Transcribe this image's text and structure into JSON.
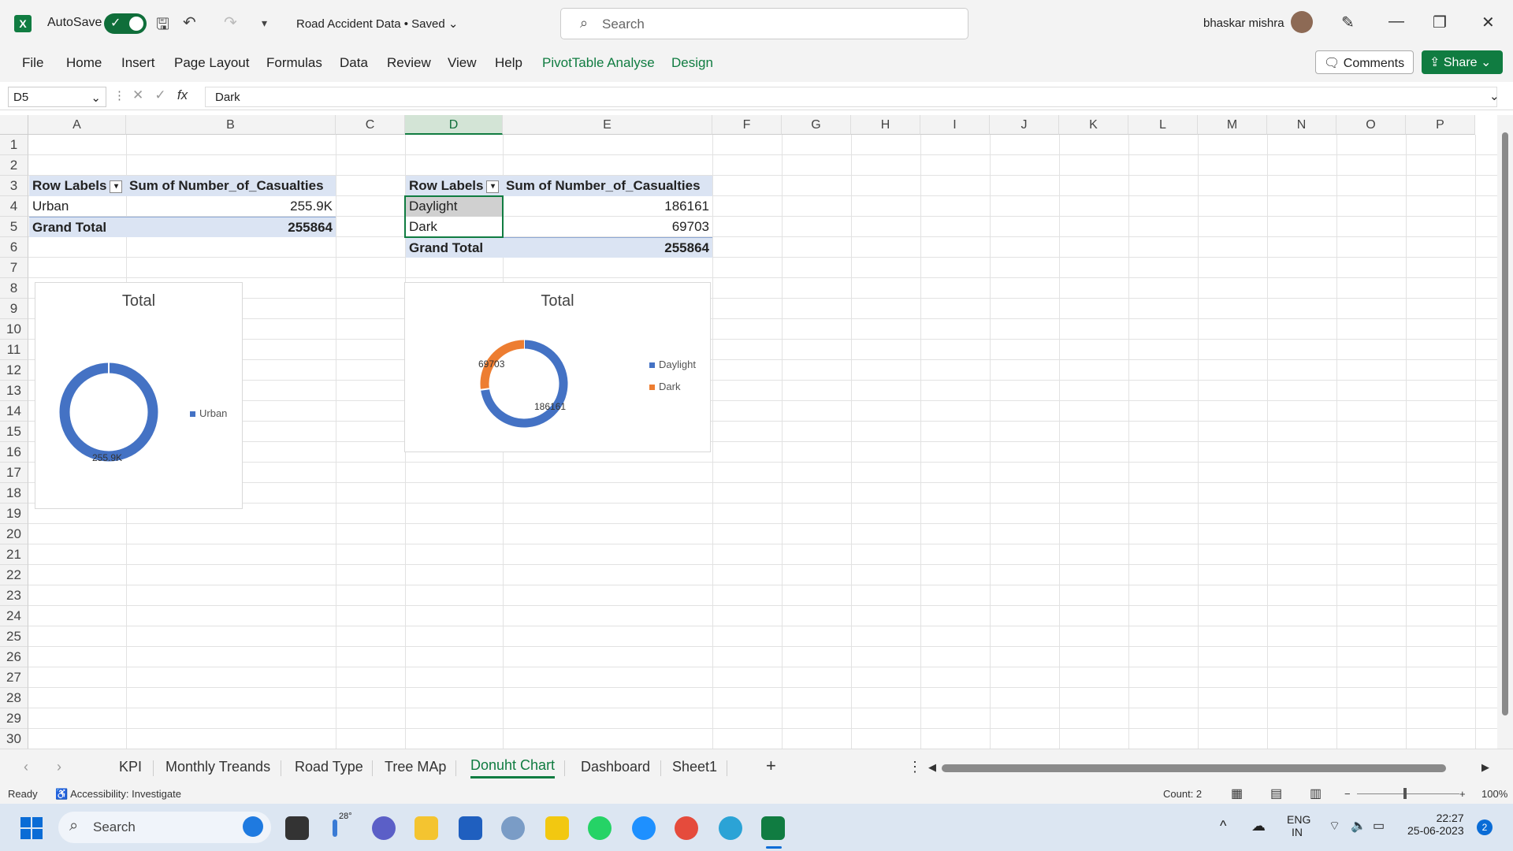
{
  "app": {
    "autosave_label": "AutoSave",
    "doc_title": "Road Accident Data • Saved",
    "search_placeholder": "Search",
    "user_name": "bhaskar mishra"
  },
  "menu": [
    "File",
    "Home",
    "Insert",
    "Page Layout",
    "Formulas",
    "Data",
    "Review",
    "View",
    "Help",
    "PivotTable Analyse",
    "Design"
  ],
  "buttons": {
    "comments": "Comments",
    "share": "Share"
  },
  "formula_bar": {
    "name_box": "D5",
    "formula": "Dark",
    "fx": "fx"
  },
  "columns": [
    "A",
    "B",
    "C",
    "D",
    "E",
    "F",
    "G",
    "H",
    "I",
    "J",
    "K",
    "L",
    "M",
    "N",
    "O",
    "P"
  ],
  "rows": [
    "1",
    "2",
    "3",
    "4",
    "5",
    "6",
    "7",
    "8",
    "9",
    "10",
    "11",
    "12",
    "13",
    "14",
    "15",
    "16",
    "17",
    "18",
    "19",
    "20",
    "21",
    "22",
    "23",
    "24",
    "25",
    "26",
    "27",
    "28",
    "29",
    "30"
  ],
  "pivot1": {
    "header_label": "Row Labels",
    "header_value": "Sum of Number_of_Casualties",
    "row_label": "Urban",
    "row_value": "255.9K",
    "total_label": "Grand Total",
    "total_value": "255864"
  },
  "pivot2": {
    "header_label": "Row Labels",
    "header_value": "Sum of Number_of_Casualties",
    "rows": [
      {
        "label": "Daylight",
        "value": "186161"
      },
      {
        "label": "Dark",
        "value": "69703"
      }
    ],
    "total_label": "Grand Total",
    "total_value": "255864"
  },
  "chart_data": [
    {
      "type": "pie",
      "variant": "donut",
      "title": "Total",
      "categories": [
        "Urban"
      ],
      "values": [
        255864
      ],
      "data_labels": [
        "255.9K"
      ],
      "legend": [
        "Urban"
      ],
      "legend_position": "right",
      "colors": [
        "#4472c4"
      ]
    },
    {
      "type": "pie",
      "variant": "donut",
      "title": "Total",
      "categories": [
        "Daylight",
        "Dark"
      ],
      "values": [
        186161,
        69703
      ],
      "data_labels": [
        "186161",
        "69703"
      ],
      "legend": [
        "Daylight",
        "Dark"
      ],
      "legend_position": "right",
      "colors": [
        "#4472c4",
        "#ed7d31"
      ]
    }
  ],
  "sheet_tabs": [
    "KPI",
    "Monthly Treands",
    "Road Type",
    "Tree MAp",
    "Donuht Chart",
    "Dashboard",
    "Sheet1"
  ],
  "active_tab": "Donuht Chart",
  "status": {
    "ready": "Ready",
    "accessibility": "Accessibility: Investigate",
    "count": "Count: 2",
    "zoom": "100%"
  },
  "taskbar": {
    "search": "Search",
    "weather": "28°",
    "lang1": "ENG",
    "lang2": "IN",
    "time": "22:27",
    "date": "25-06-2023",
    "notif": "2"
  },
  "colors": {
    "accent": "#107c41",
    "pivot_header": "#dbe4f3",
    "series_blue": "#4472c4",
    "series_orange": "#ed7d31"
  }
}
